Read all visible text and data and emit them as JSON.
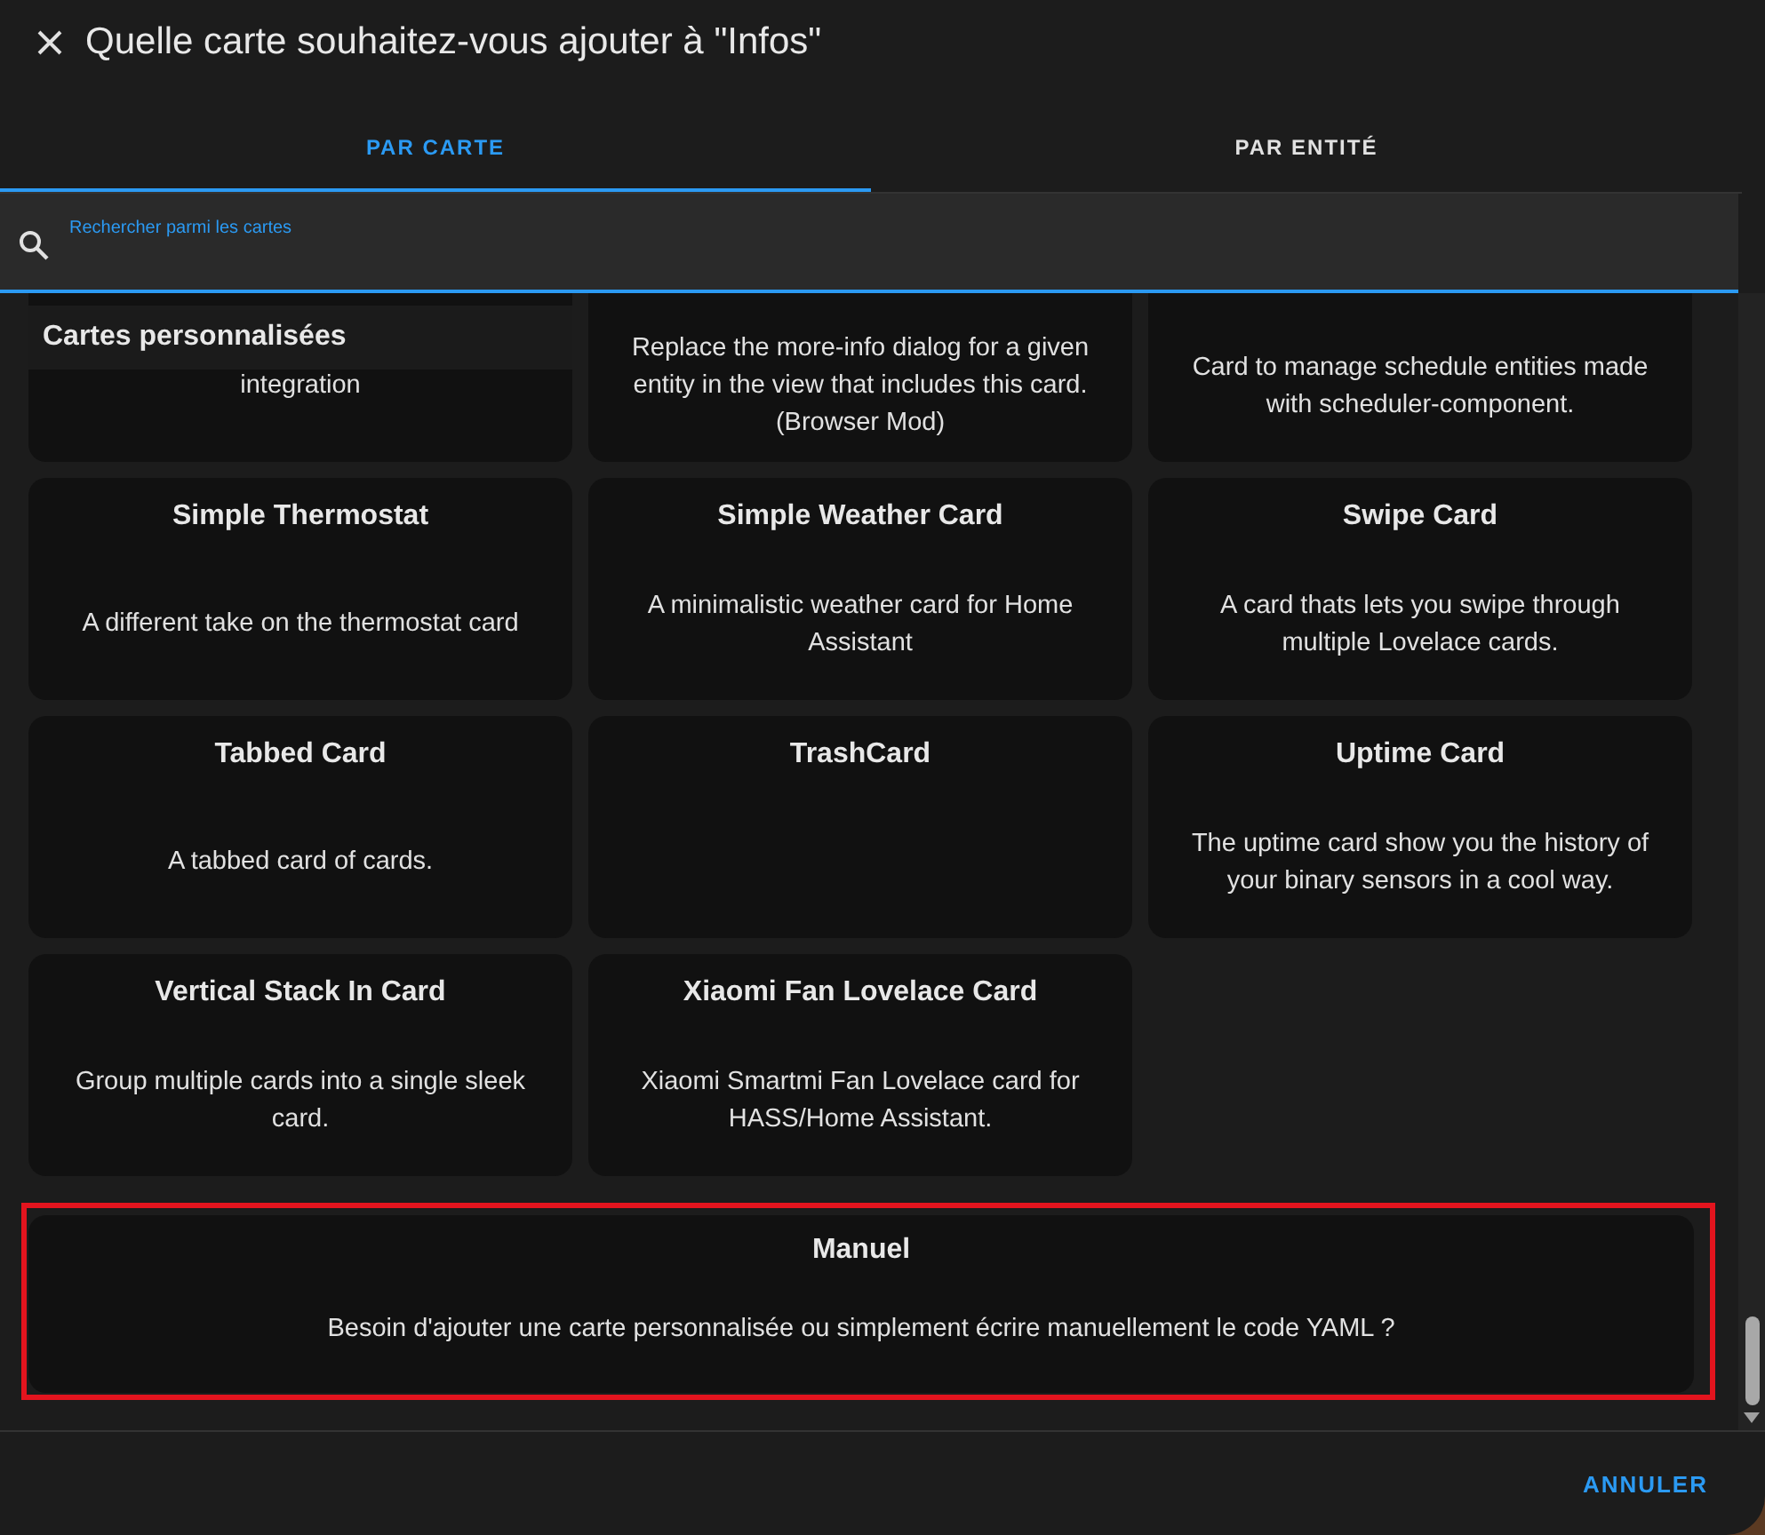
{
  "dialog": {
    "title": "Quelle carte souhaitez-vous ajouter à \"Infos\""
  },
  "tabs": [
    {
      "label": "PAR CARTE",
      "selected": true
    },
    {
      "label": "PAR ENTITÉ",
      "selected": false
    }
  ],
  "search": {
    "label": "Rechercher parmi les cartes"
  },
  "section_header": "Cartes personnalisées",
  "cards": [
    {
      "description": "integration"
    },
    {
      "description": "Replace the more-info dialog for a given entity in the view that includes this card. (Browser Mod)"
    },
    {
      "description": "Card to manage schedule entities made with scheduler-component."
    },
    {
      "title": "Simple Thermostat",
      "description": "A different take on the thermostat card"
    },
    {
      "title": "Simple Weather Card",
      "description": "A minimalistic weather card for Home Assistant"
    },
    {
      "title": "Swipe Card",
      "description": "A card thats lets you swipe through multiple Lovelace cards."
    },
    {
      "title": "Tabbed Card",
      "description": "A tabbed card of cards."
    },
    {
      "title": "TrashCard"
    },
    {
      "title": "Uptime Card",
      "description": "The uptime card show you the history of your binary sensors in a cool way."
    },
    {
      "title": "Vertical Stack In Card",
      "description": "Group multiple cards into a single sleek card."
    },
    {
      "title": "Xiaomi Fan Lovelace Card",
      "description": "Xiaomi Smartmi Fan Lovelace card for HASS/Home Assistant."
    }
  ],
  "manual_card": {
    "title": "Manuel",
    "description": "Besoin d'ajouter une carte personnalisée ou simplement écrire manuellement le code YAML ?",
    "highlighted": true
  },
  "footer": {
    "button": "ANNULER"
  }
}
